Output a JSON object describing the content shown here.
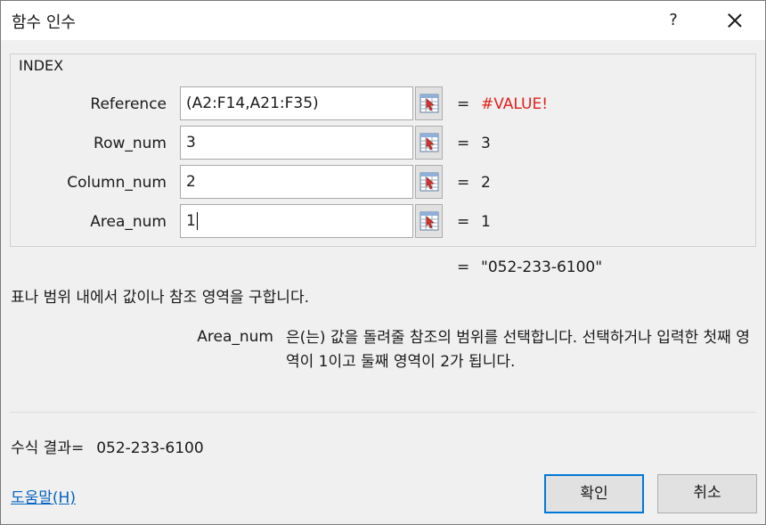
{
  "window": {
    "title": "함수 인수",
    "help_label": "?"
  },
  "function": {
    "name": "INDEX",
    "args": [
      {
        "label": "Reference",
        "value": "(A2:F14,A21:F35)",
        "equals": "=",
        "result": "#VALUE!"
      },
      {
        "label": "Row_num",
        "value": "3",
        "equals": "=",
        "result": "3"
      },
      {
        "label": "Column_num",
        "value": "2",
        "equals": "=",
        "result": "2"
      },
      {
        "label": "Area_num",
        "value": "1",
        "equals": "=",
        "result": "1"
      }
    ],
    "result_equals": "=",
    "result": "\"052-233-6100\"",
    "description": "표나 범위 내에서 값이나 참조 영역을 구합니다.",
    "arg_help_name": "Area_num",
    "arg_help_text": "은(는) 값을 돌려줄 참조의 범위를 선택합니다. 선택하거나 입력한 첫째 영역이 1이고 둘째 영역이 2가 됩니다."
  },
  "footer": {
    "formula_result_label": "수식 결과=",
    "formula_result_value": "052-233-6100",
    "help_link": "도움말(H)",
    "ok_label": "확인",
    "cancel_label": "취소"
  },
  "colors": {
    "error": "#e0201e",
    "link": "#0563c1",
    "focus": "#0078d7"
  }
}
